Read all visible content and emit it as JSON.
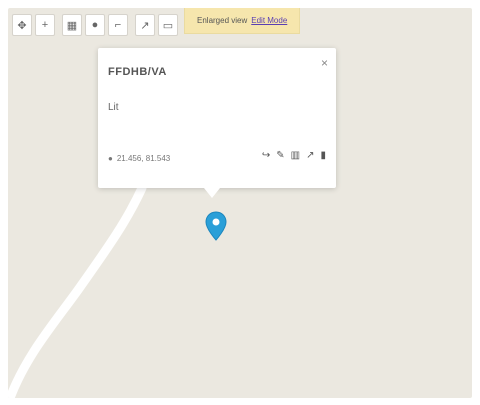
{
  "toolbar": {
    "icons": [
      "pan-icon",
      "zoom-icon",
      "layers-icon",
      "marker-icon",
      "ruler-icon",
      "link-icon",
      "share-icon"
    ]
  },
  "notice": {
    "text": "Enlarged view",
    "link_label": "Edit Mode"
  },
  "popup": {
    "title": "FFDHB/VA",
    "value": "Lit",
    "coordinates": "21.456, 81.543",
    "close_symbol": "×",
    "action_icons": [
      "directions-icon",
      "edit-icon",
      "delete-icon",
      "share-icon",
      "info-icon"
    ]
  },
  "map": {
    "land_color": "#ebe8e0",
    "road_color": "#ffffff",
    "marker_color": "#2a9fd8"
  }
}
